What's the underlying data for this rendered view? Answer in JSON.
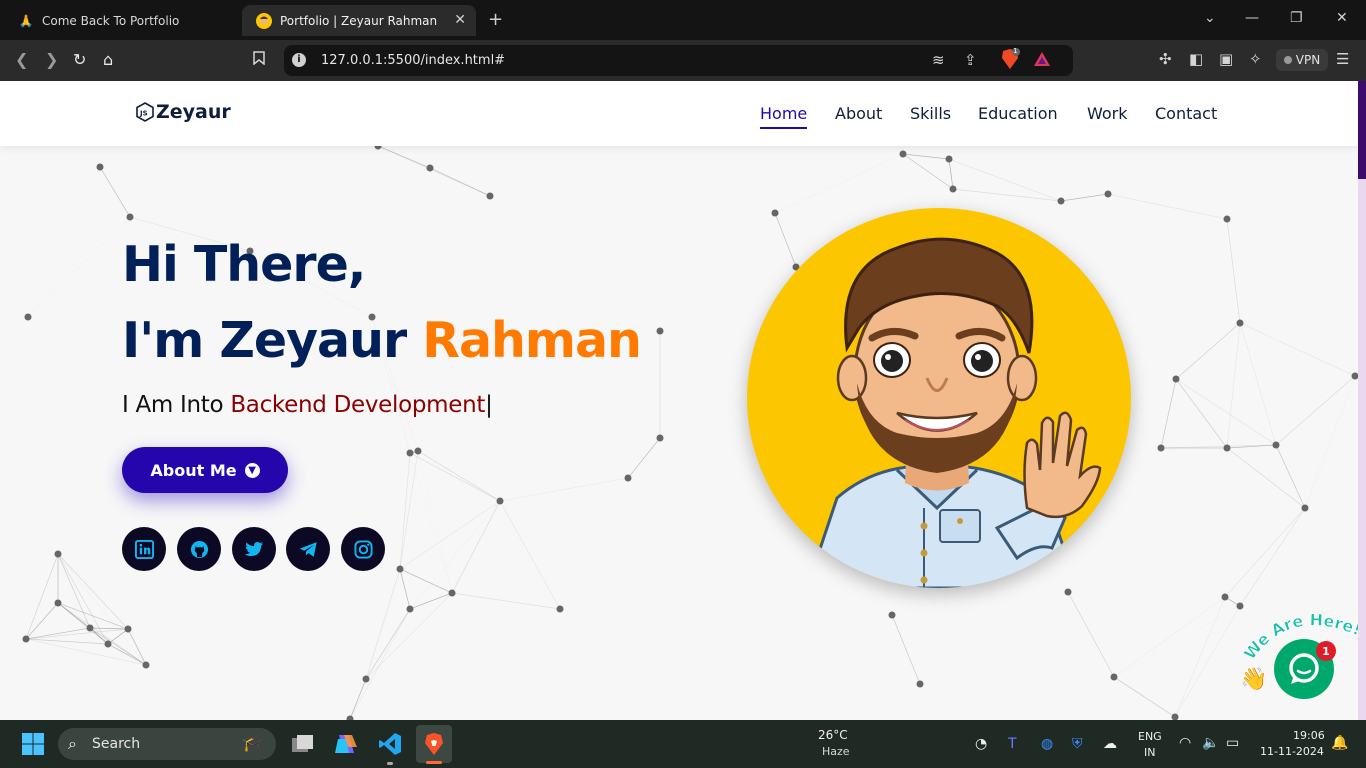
{
  "browser": {
    "tabs": [
      {
        "title": "Come Back To Portfolio",
        "icon": "praying-hands-icon",
        "active": false
      },
      {
        "title": "Portfolio | Zeyaur Rahman",
        "icon": "avatar-favicon-icon",
        "active": true
      }
    ],
    "url": "127.0.0.1:5500/index.html#",
    "shield_badge": "1",
    "vpn_label": "VPN"
  },
  "site": {
    "logo_text": "Zeyaur",
    "nav": [
      {
        "label": "Home",
        "active": true
      },
      {
        "label": "About"
      },
      {
        "label": "Skills"
      },
      {
        "label": "Education"
      },
      {
        "label": "Work"
      },
      {
        "label": "Contact"
      }
    ],
    "hero": {
      "greeting": "Hi There,",
      "intro_prefix": "I'm Zeyaur ",
      "intro_highlight": "Rahman",
      "sub_prefix": "I Am Into ",
      "sub_typed": "Backend Development",
      "cursor": "|",
      "button_label": "About Me"
    },
    "socials": [
      "linkedin-icon",
      "github-icon",
      "twitter-icon",
      "telegram-icon",
      "instagram-icon"
    ],
    "chat": {
      "caption": "We Are Here!",
      "badge": "1"
    }
  },
  "colors": {
    "primary": "#2506ad",
    "accent": "#ff7a00",
    "heading": "#002057",
    "typed": "#8b0000",
    "avatar_bg": "#fcc600"
  },
  "taskbar": {
    "search_placeholder": "Search",
    "weather_temp": "26°C",
    "weather_desc": "Haze",
    "lang_line1": "ENG",
    "lang_line2": "IN",
    "time": "19:06",
    "date": "11-11-2024"
  }
}
